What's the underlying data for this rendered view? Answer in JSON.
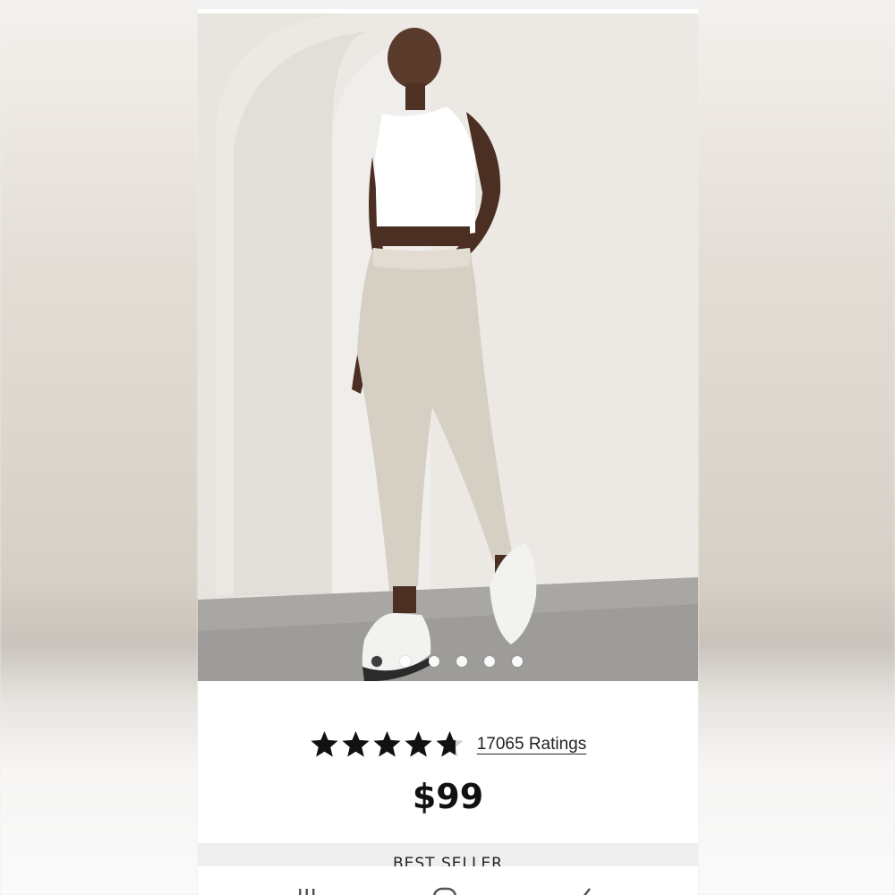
{
  "product": {
    "rating_value": 4.7,
    "rating_max": 5,
    "ratings_count_label": "17065 Ratings",
    "price": "$99",
    "badge": "BEST SELLER"
  },
  "carousel": {
    "total_slides": 6,
    "active_index": 0
  },
  "colors": {
    "star": "#111111",
    "star_empty": "#d0d0d0",
    "badge_bg": "#efefef"
  },
  "nav": {
    "icons": [
      "recent-apps-icon",
      "home-icon",
      "back-icon"
    ]
  }
}
